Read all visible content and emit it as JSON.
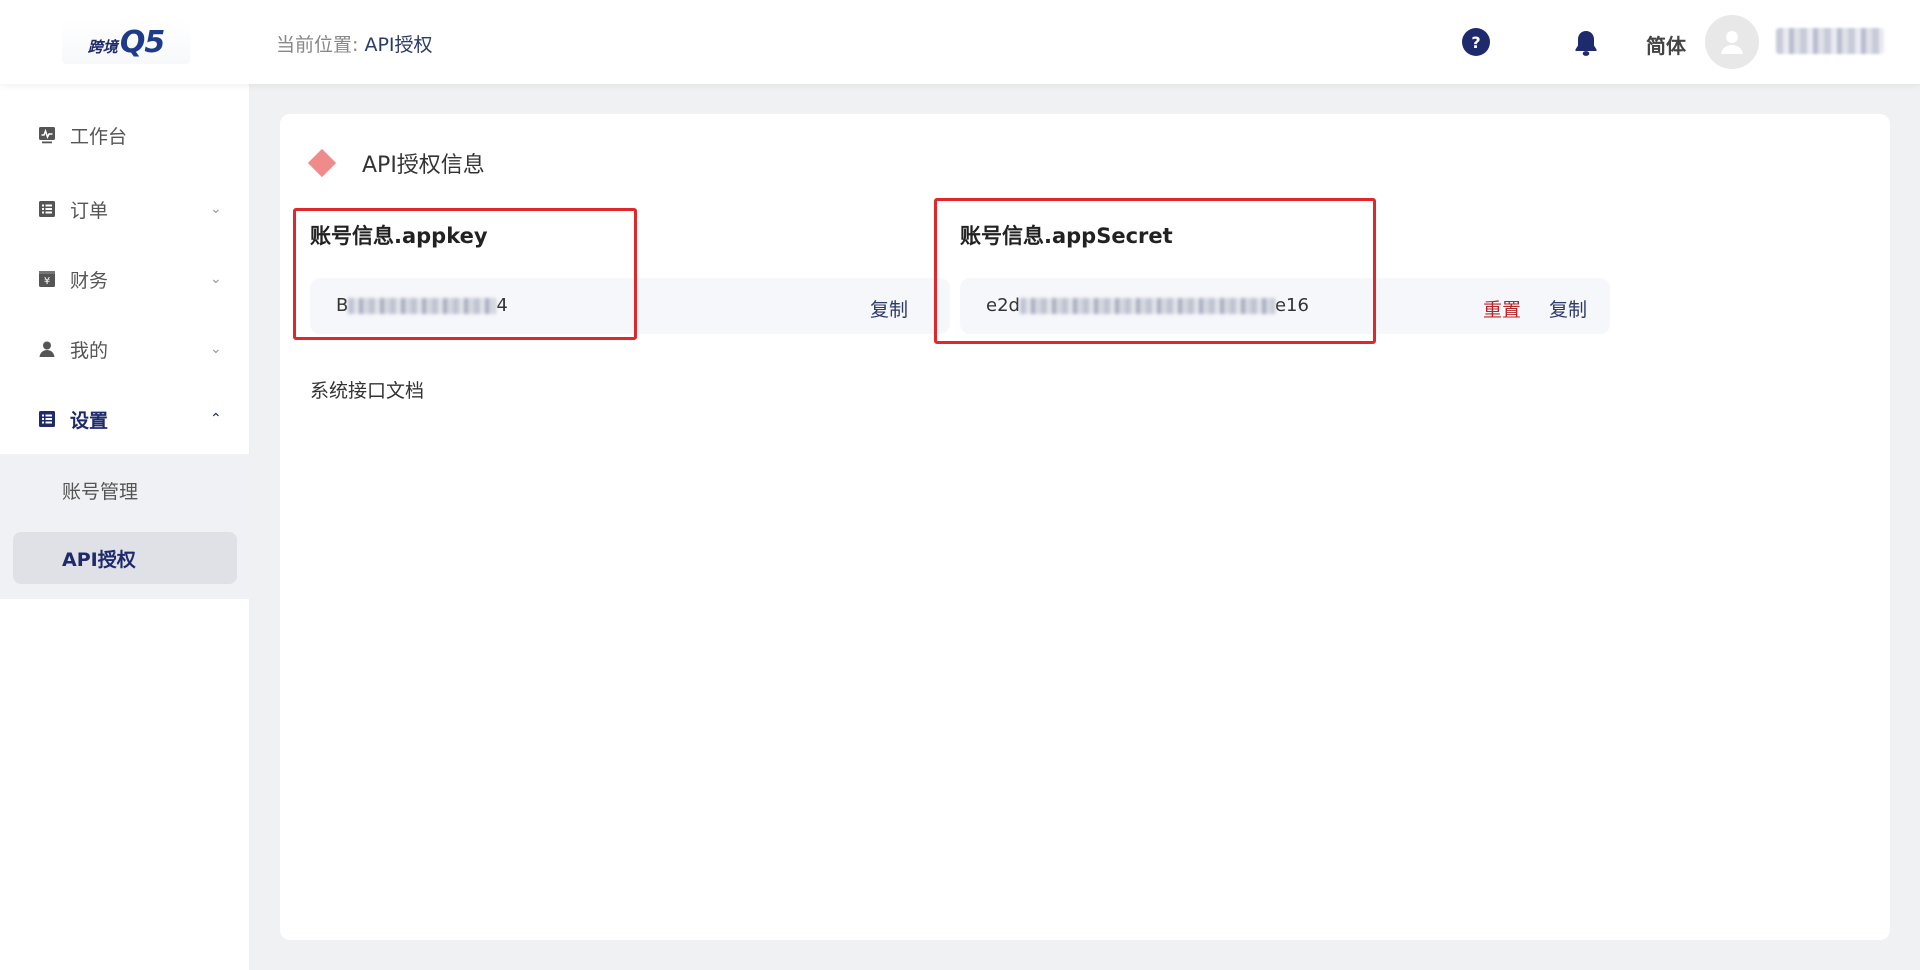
{
  "header": {
    "logo_small": "跨境",
    "logo_big": "Q5",
    "breadcrumb_prefix": "当前位置:",
    "breadcrumb_current": "API授权",
    "help_glyph": "?",
    "language": "简体"
  },
  "sidebar": {
    "items": [
      {
        "label": "工作台",
        "icon": "dashboard-icon"
      },
      {
        "label": "订单",
        "icon": "list-icon"
      },
      {
        "label": "财务",
        "icon": "finance-icon"
      },
      {
        "label": "我的",
        "icon": "user-icon"
      },
      {
        "label": "设置",
        "icon": "settings-list-icon"
      }
    ],
    "submenu": [
      {
        "label": "账号管理"
      },
      {
        "label": "API授权"
      }
    ]
  },
  "main": {
    "section_title": "API授权信息",
    "appkey": {
      "label": "账号信息.appkey",
      "value_start": "B",
      "value_end": "4",
      "copy_label": "复制"
    },
    "appsecret": {
      "label": "账号信息.appSecret",
      "value_start": "e2d",
      "value_end": "e16",
      "reset_label": "重置",
      "copy_label": "复制"
    },
    "doc_link": "系统接口文档"
  },
  "colors": {
    "brand": "#1e2a6b",
    "accent_diamond": "#f08b8b",
    "highlight_border": "#e0272b",
    "reset_red": "#b4262a"
  }
}
